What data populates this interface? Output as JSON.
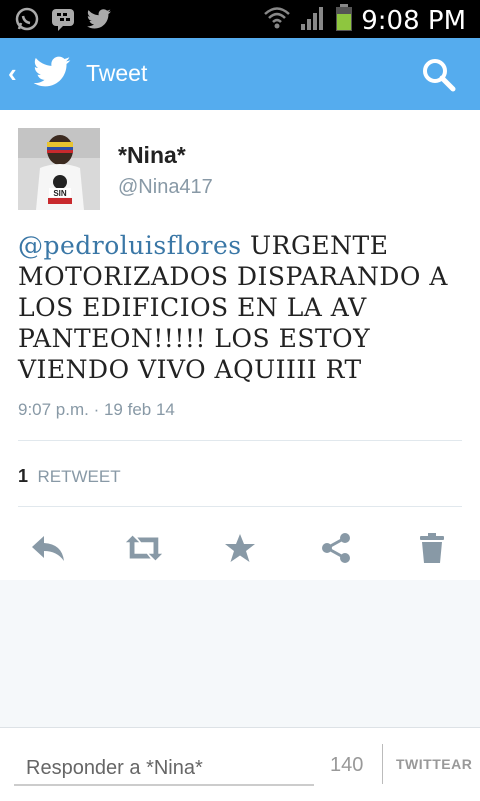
{
  "status_bar": {
    "time": "9:08 PM",
    "left_icons": [
      "whatsapp-icon",
      "bbm-icon",
      "twitter-icon"
    ],
    "right_icons": [
      "wifi-icon",
      "signal-icon",
      "battery-icon"
    ]
  },
  "action_bar": {
    "back_symbol": "‹",
    "title": "Tweet",
    "color": "#55acee"
  },
  "tweet": {
    "display_name": "*Nina*",
    "handle": "@Nina417",
    "mention": "@pedroluisflores",
    "text": " URGENTE MOTORIZADOS DISPARANDO A LOS EDIFICIOS EN LA AV PANTEON!!!!! LOS ESTOY VIENDO VIVO AQUIIII RT",
    "timestamp": "9:07 p.m. · 19 feb 14",
    "retweet_count": "1",
    "retweet_label": "RETWEET",
    "avatar_text": "SIN"
  },
  "actions": [
    "reply-icon",
    "retweet-icon",
    "favorite-icon",
    "share-icon",
    "delete-icon"
  ],
  "composer": {
    "placeholder": "Responder a *Nina*",
    "char_count": "140",
    "tweet_button": "TWITTEAR"
  }
}
